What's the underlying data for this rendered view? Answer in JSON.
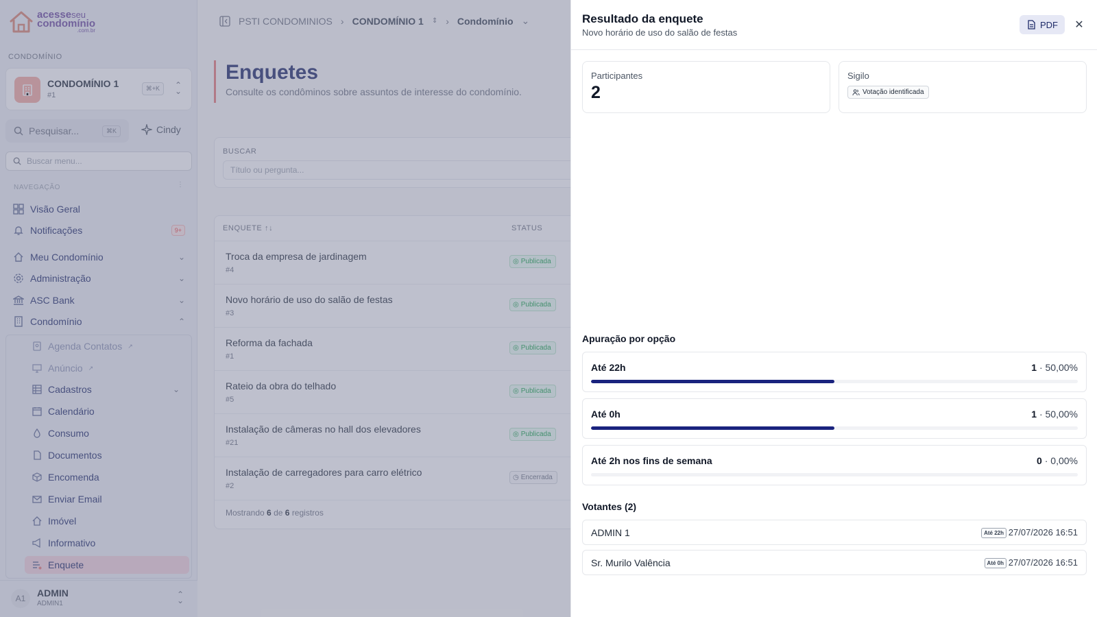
{
  "sidebar": {
    "logo": {
      "line1": "acesse",
      "line1b": "seu",
      "line2": "condomínio",
      "suffix": ".com.br"
    },
    "section_label": "CONDOMÍNIO",
    "condo": {
      "name": "CONDOMÍNIO 1",
      "number": "#1",
      "shortcut": "⌘+K"
    },
    "search": {
      "label": "Pesquisar...",
      "shortcut": "⌘K"
    },
    "assistant": "Cindy",
    "menu_search_placeholder": "Buscar menu...",
    "nav_label": "NAVEGAÇÃO",
    "top_items": [
      {
        "label": "Visão Geral",
        "icon": "grid-icon"
      },
      {
        "label": "Notificações",
        "icon": "bell-icon",
        "badge": "9+"
      }
    ],
    "groups": [
      {
        "label": "Meu Condomínio",
        "icon": "home-icon"
      },
      {
        "label": "Administração",
        "icon": "gear-icon"
      },
      {
        "label": "ASC Bank",
        "icon": "bank-icon"
      },
      {
        "label": "Condomínio",
        "icon": "building-icon"
      }
    ],
    "sub_items": [
      {
        "label": "Agenda Contatos",
        "icon": "contacts-icon",
        "external": true
      },
      {
        "label": "Anúncio",
        "icon": "monitor-icon",
        "external": true
      },
      {
        "label": "Cadastros",
        "icon": "table-icon"
      },
      {
        "label": "Calendário",
        "icon": "calendar-icon"
      },
      {
        "label": "Consumo",
        "icon": "drop-icon"
      },
      {
        "label": "Documentos",
        "icon": "document-icon"
      },
      {
        "label": "Encomenda",
        "icon": "package-icon"
      },
      {
        "label": "Enviar Email",
        "icon": "mail-icon"
      },
      {
        "label": "Imóvel",
        "icon": "house-icon"
      },
      {
        "label": "Informativo",
        "icon": "megaphone-icon"
      },
      {
        "label": "Enquete",
        "icon": "poll-icon"
      }
    ],
    "user": {
      "initials": "A1",
      "name": "ADMIN",
      "sub": "ADMIN1"
    }
  },
  "breadcrumb": [
    "PSTI CONDOMINIOS",
    "CONDOMÍNIO 1",
    "Condomínio"
  ],
  "page": {
    "title": "Enquetes",
    "subtitle": "Consulte os condôminos sobre assuntos de interesse do condomínio."
  },
  "filter": {
    "label": "BUSCAR",
    "placeholder": "Título ou pergunta..."
  },
  "table": {
    "col_enquete": "ENQUETE",
    "col_status": "STATUS",
    "rows": [
      {
        "title": "Troca da empresa de jardinagem",
        "id": "#4",
        "status": "Publicada"
      },
      {
        "title": "Novo horário de uso do salão de festas",
        "id": "#3",
        "status": "Publicada"
      },
      {
        "title": "Reforma da fachada",
        "id": "#1",
        "status": "Publicada"
      },
      {
        "title": "Rateio da obra do telhado",
        "id": "#5",
        "status": "Publicada"
      },
      {
        "title": "Instalação de câmeras no hall dos elevadores",
        "id": "#21",
        "status": "Publicada"
      },
      {
        "title": "Instalação de carregadores para carro elétrico",
        "id": "#2",
        "status": "Encerrada"
      }
    ],
    "footer": {
      "prefix": "Mostrando",
      "shown": "6",
      "mid": "de",
      "total": "6",
      "suffix": "registros"
    }
  },
  "drawer": {
    "title": "Resultado da enquete",
    "subtitle": "Novo horário de uso do salão de festas",
    "pdf_label": "PDF",
    "participants_label": "Participantes",
    "participants_value": "2",
    "secrecy_label": "Sigilo",
    "secrecy_value": "Votação identificada",
    "options_title": "Apuração por opção",
    "options": [
      {
        "name": "Até 22h",
        "votes": "1",
        "percent": "50,00%",
        "fraction": 0.5
      },
      {
        "name": "Até 0h",
        "votes": "1",
        "percent": "50,00%",
        "fraction": 0.5
      },
      {
        "name": "Até 2h nos fins de semana",
        "votes": "0",
        "percent": "0,00%",
        "fraction": 0
      }
    ],
    "voters_title": "Votantes (2)",
    "voters": [
      {
        "name": "ADMIN 1",
        "choice": "Até 22h",
        "datetime": "27/07/2026 16:51"
      },
      {
        "name": "Sr. Murilo Valência",
        "choice": "Até 0h",
        "datetime": "27/07/2026 16:51"
      }
    ]
  },
  "colors": {
    "accent": "#1a237e",
    "brand": "#6b4aa0",
    "highlight": "#e67a7a"
  }
}
